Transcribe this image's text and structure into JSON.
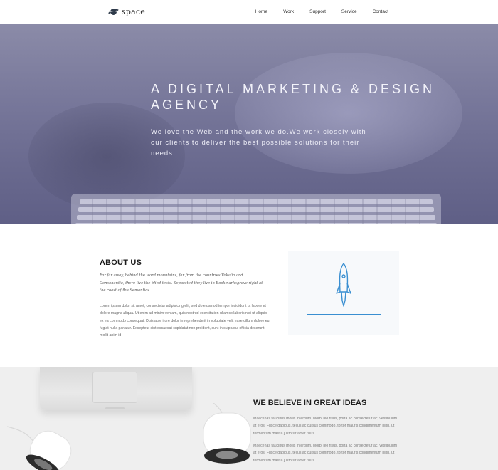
{
  "header": {
    "logo_text": "space",
    "logo_icon": "planet-icon",
    "nav": [
      "Home",
      "Work",
      "Support",
      "Service",
      "Contact"
    ]
  },
  "hero": {
    "title": "A DIGITAL MARKETING & DESIGN AGENCY",
    "subtitle": "We love the Web and the work we do.We work closely with our clients to deliver the best possible solutions for their needs"
  },
  "about": {
    "title": "ABOUT US",
    "lead": "Far far away, behind the word mountains, far from the countries Vokalia and Consonantia, there live the blind texts. Separated they live in Bookmarksgrove right at the coast of the Semantics",
    "body": "Lorem ipsum dolor sit amet, consectetur adipisicing elit, sed do eiusmod tempor incididunt ut labore et dolore magna aliqua. Ut enim ad minim veniam, quis nostrud exercitation ullamco laboris nisi ut aliquip ex ea commodo consequat. Duis aute irure dolor in reprehenderit in voluptate velit esse cillum dolore eu fugiat nulla pariatur. Excepteur sint occaecat cupidatat non proident, sunt in culpa qui officia deserunt mollit anim id",
    "illustration_icon": "rocket-icon",
    "accent_color": "#3a8fd1"
  },
  "believe": {
    "title": "WE BELIEVE IN GREAT IDEAS",
    "paragraphs": [
      "Maecenas faucibus mollis interdum. Morbi leo risus, porta ac consectetur ac, vestibulum at eros. Fusce dapibus, tellus ac cursus commodo, tortor mauris condimentum nibh, ut fermentum massa justo sit amet risus.",
      "Maecenas faucibus mollis interdum. Morbi leo risus, porta ac consectetur ac, vestibulum at eros. Fusce dapibus, tellus ac cursus commodo, tortor mauris condimentum nibh, ut fermentum massa justo sit amet risus."
    ]
  }
}
